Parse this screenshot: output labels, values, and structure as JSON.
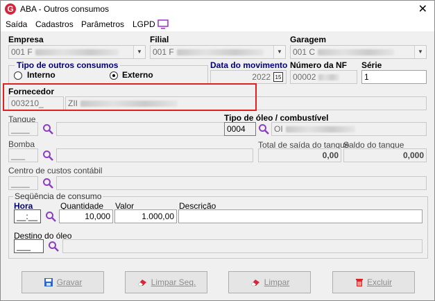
{
  "window": {
    "title": "ABA - Outros consumos",
    "close": "✕"
  },
  "menu": [
    "Saída",
    "Cadastros",
    "Parâmetros",
    "LGPD"
  ],
  "empresa": {
    "label": "Empresa",
    "value": "001 F"
  },
  "filial": {
    "label": "Filial",
    "value": "001 F"
  },
  "garagem": {
    "label": "Garagem",
    "value": "001 C"
  },
  "tipo_outros": {
    "label": "Tipo de outros consumos",
    "interno": "Interno",
    "externo": "Externo",
    "selected": "Externo"
  },
  "data_mov": {
    "label": "Data do movimento",
    "value": "2022",
    "cal_icon": "15"
  },
  "numero_nf": {
    "label": "Número da NF",
    "value": "00002"
  },
  "serie": {
    "label": "Série",
    "value": "1"
  },
  "fornecedor": {
    "label": "Fornecedor",
    "code": "003210_",
    "name": "ZII"
  },
  "tanque": {
    "label": "Tanque",
    "value": "____"
  },
  "tipo_oleo": {
    "label": "Tipo de óleo / combustível",
    "code": "0004",
    "name": "OI"
  },
  "bomba": {
    "label": "Bomba",
    "value": "___"
  },
  "total_saida": {
    "label": "Total de saída do tanque",
    "value": "0,00"
  },
  "saldo_tanque": {
    "label": "Saldo do tanque",
    "value": "0,000"
  },
  "centro_custos": {
    "label": "Centro de custos contábil",
    "value": "____"
  },
  "sequencia": {
    "label": "Seqüência de consumo",
    "hora_label": "Hora",
    "hora_value": "__:__",
    "quantidade_label": "Quantidade",
    "quantidade_value": "10,000",
    "valor_label": "Valor",
    "valor_value": "1.000,00",
    "descricao_label": "Descrição",
    "descricao_value": "",
    "destino_label": "Destino do óleo",
    "destino_value": "___"
  },
  "buttons": {
    "gravar": "Gravar",
    "limpar_seq": "Limpar Seq.",
    "limpar": "Limpar",
    "excluir": "Excluir"
  },
  "colors": {
    "highlight": "#e0201c",
    "accent_navy": "#00007a",
    "magnifier": "#8b3fbf"
  }
}
